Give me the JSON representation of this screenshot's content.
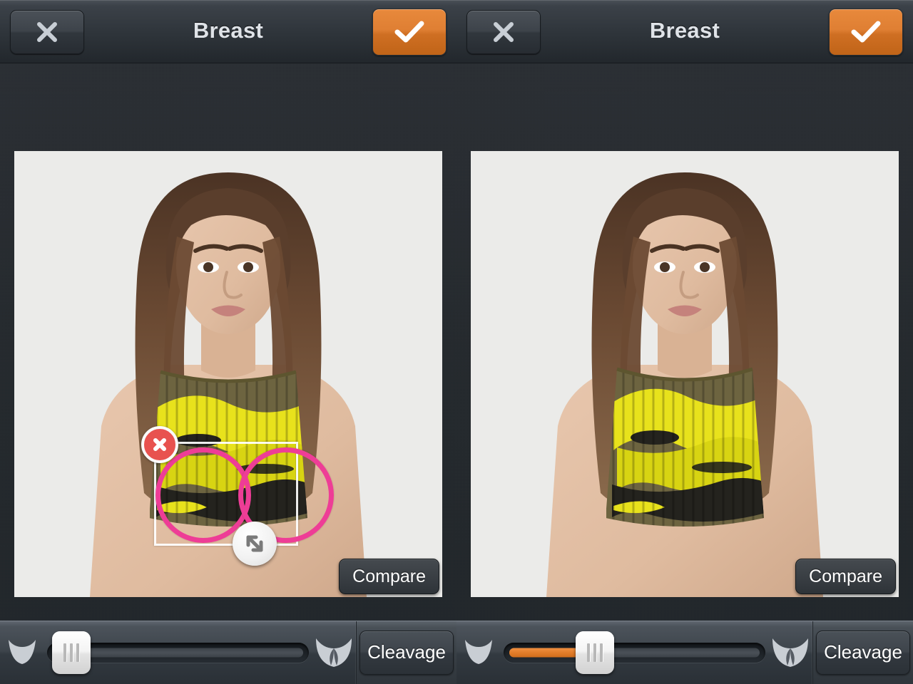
{
  "app": {
    "accent_orange": "#DF7F33",
    "ring_color": "#EE3D96",
    "delete_color": "#E8524F",
    "bg_dark": "#262B30"
  },
  "panels": [
    {
      "id": "left",
      "header": {
        "title": "Breast",
        "cancel_label": "✕",
        "cancel_icon": "close-icon",
        "confirm_label": "✓",
        "confirm_icon": "checkmark-icon"
      },
      "photo": {
        "compare_label": "Compare",
        "subject": "woman with long brown hair wearing yellow and black camouflage tank top",
        "background": "#EBEBE9"
      },
      "overlay": {
        "visible": true,
        "delete_icon": "delete-badge-icon",
        "resize_icon": "resize-diagonal-icon",
        "circles": 2
      },
      "toolbar": {
        "min_icon": "small-bra-icon",
        "max_icon": "large-bra-icon",
        "slider_value": 0,
        "slider_min": 0,
        "slider_max": 100,
        "cleavage_label": "Cleavage"
      }
    },
    {
      "id": "right",
      "header": {
        "title": "Breast",
        "cancel_label": "✕",
        "cancel_icon": "close-icon",
        "confirm_label": "✓",
        "confirm_icon": "checkmark-icon"
      },
      "photo": {
        "compare_label": "Compare",
        "subject": "woman with long brown hair wearing yellow and black camouflage tank top",
        "background": "#EBEBE9"
      },
      "overlay": {
        "visible": false,
        "delete_icon": "delete-badge-icon",
        "resize_icon": "resize-diagonal-icon",
        "circles": 0
      },
      "toolbar": {
        "min_icon": "small-bra-icon",
        "max_icon": "large-bra-icon",
        "slider_value": 32,
        "slider_min": 0,
        "slider_max": 100,
        "cleavage_label": "Cleavage"
      }
    }
  ]
}
